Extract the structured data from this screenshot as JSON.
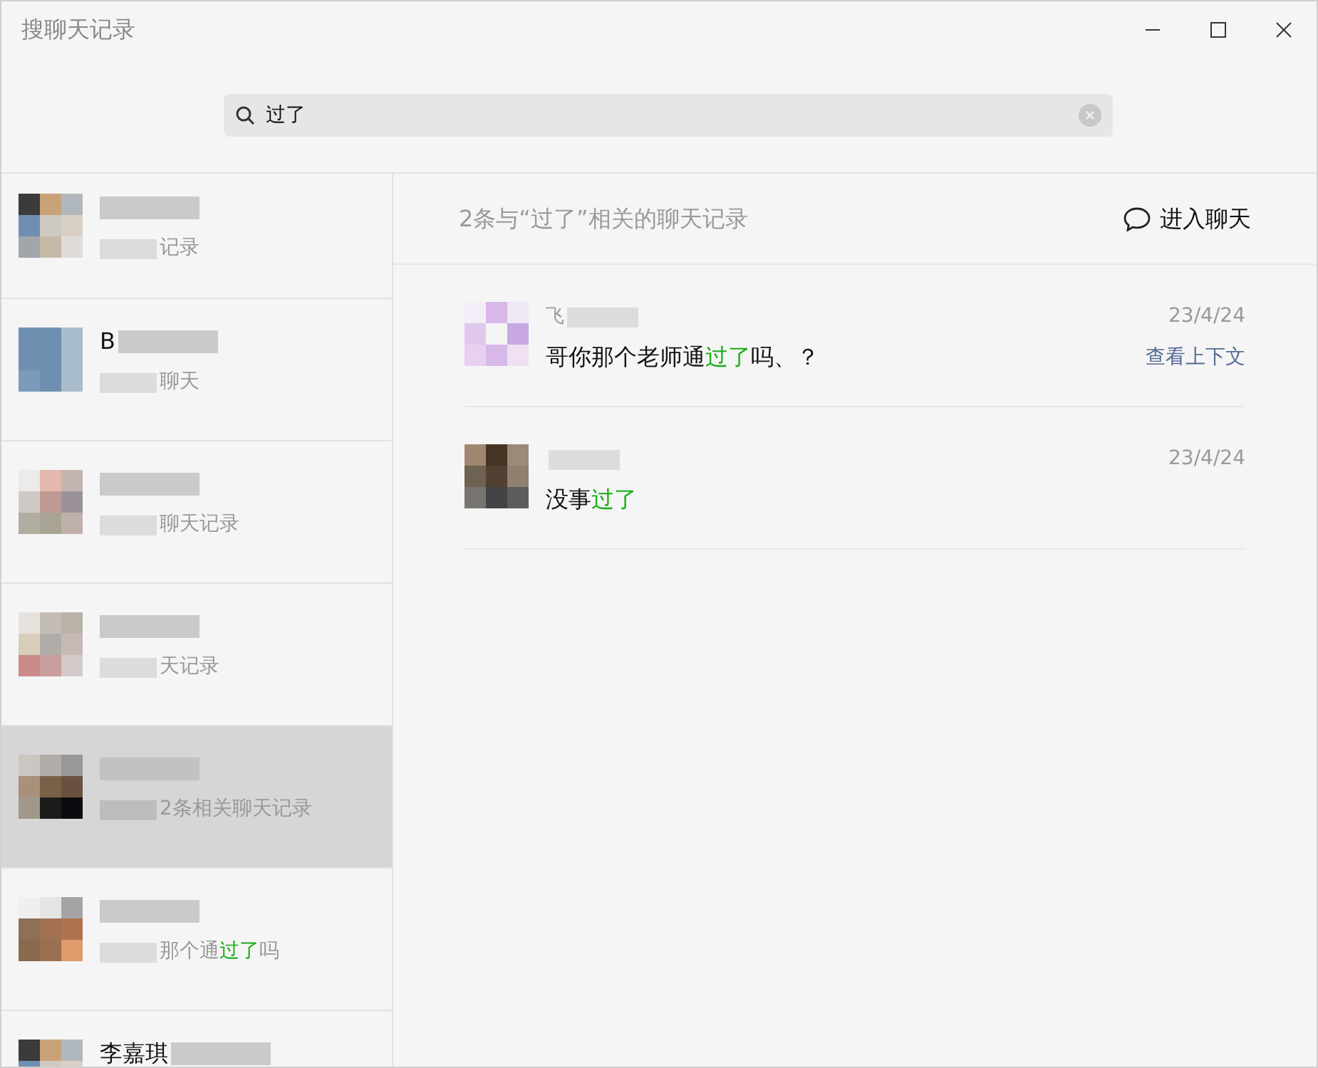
{
  "window": {
    "title": "搜聊天记录"
  },
  "search": {
    "value": "过了"
  },
  "sidebar": {
    "items": [
      {
        "subtitle": [
          {
            "text": "记录",
            "highlight": false
          }
        ],
        "selected": false
      },
      {
        "name": "B",
        "subtitle": [
          {
            "text": "聊天",
            "highlight": false
          }
        ],
        "selected": false
      },
      {
        "subtitle": [
          {
            "text": "聊天记录",
            "highlight": false
          }
        ],
        "selected": false
      },
      {
        "subtitle": [
          {
            "text": "天记录",
            "highlight": false
          }
        ],
        "selected": false
      },
      {
        "subtitle": [
          {
            "text": "2条相关聊天记录",
            "highlight": false
          }
        ],
        "selected": true
      },
      {
        "subtitle": [
          {
            "text": "那个通",
            "highlight": false
          },
          {
            "text": "过了",
            "highlight": true
          },
          {
            "text": "吗",
            "highlight": false
          }
        ],
        "selected": false
      },
      {
        "name": "李嘉琪",
        "selected": false
      }
    ]
  },
  "results": {
    "summary": "2条与“过了”相关的聊天记录",
    "open_chat": "进入聊天",
    "messages": [
      {
        "sender": "飞",
        "text": [
          {
            "text": "哥你那个老师通",
            "highlight": false
          },
          {
            "text": "过了",
            "highlight": true
          },
          {
            "text": "吗、？",
            "highlight": false
          }
        ],
        "date": "23/4/24",
        "context_link": "查看上下文"
      },
      {
        "text": [
          {
            "text": "没事",
            "highlight": false
          },
          {
            "text": "过了",
            "highlight": true
          }
        ],
        "date": "23/4/24"
      }
    ]
  }
}
